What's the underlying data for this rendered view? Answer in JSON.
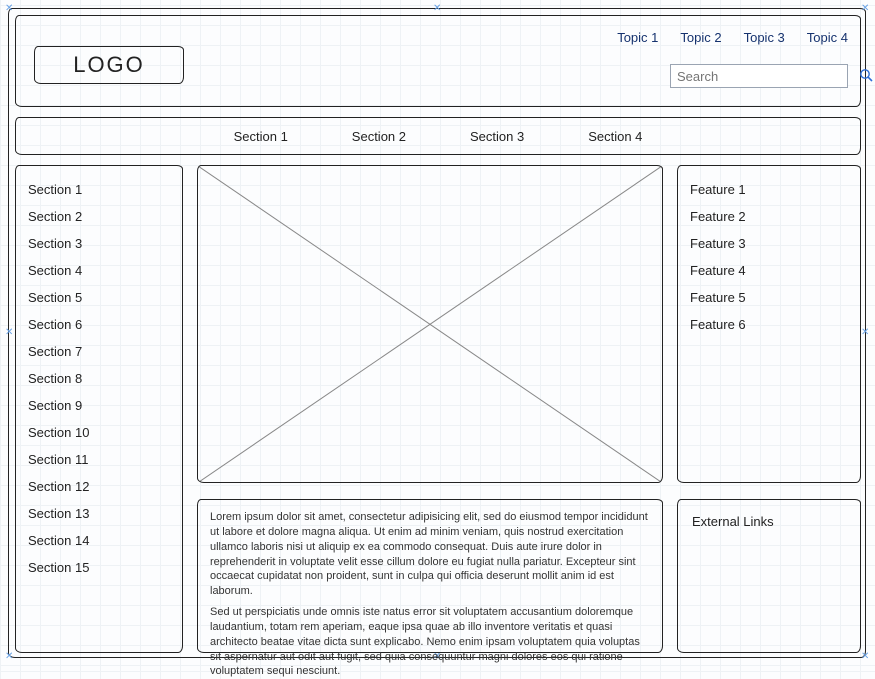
{
  "header": {
    "logo": "LOGO",
    "topics": [
      "Topic 1",
      "Topic 2",
      "Topic 3",
      "Topic 4"
    ],
    "search_placeholder": "Search"
  },
  "topnav": [
    "Section 1",
    "Section 2",
    "Section 3",
    "Section 4"
  ],
  "sidebar": [
    "Section 1",
    "Section 2",
    "Section 3",
    "Section 4",
    "Section 5",
    "Section 6",
    "Section 7",
    "Section 8",
    "Section 9",
    "Section 10",
    "Section 11",
    "Section 12",
    "Section 13",
    "Section 14",
    "Section 15"
  ],
  "features": [
    "Feature 1",
    "Feature 2",
    "Feature 3",
    "Feature 4",
    "Feature 5",
    "Feature 6"
  ],
  "body": {
    "p1": "Lorem ipsum dolor sit amet, consectetur adipisicing elit, sed do eiusmod tempor incididunt ut labore et dolore magna aliqua. Ut enim ad minim veniam, quis nostrud exercitation ullamco laboris nisi ut aliquip ex ea commodo consequat. Duis aute irure dolor in reprehenderit in voluptate velit esse cillum dolore eu fugiat nulla pariatur. Excepteur sint occaecat cupidatat non proident, sunt in culpa qui officia deserunt mollit anim id est laborum.",
    "p2": "Sed ut perspiciatis unde omnis iste natus error sit voluptatem accusantium doloremque laudantium, totam rem aperiam, eaque ipsa quae ab illo inventore veritatis et quasi architecto beatae vitae dicta sunt explicabo. Nemo enim ipsam voluptatem quia voluptas sit aspernatur aut odit aut fugit, sed quia consequuntur magni dolores eos qui ratione voluptatem sequi nesciunt."
  },
  "right_bottom": {
    "title": "External Links"
  }
}
